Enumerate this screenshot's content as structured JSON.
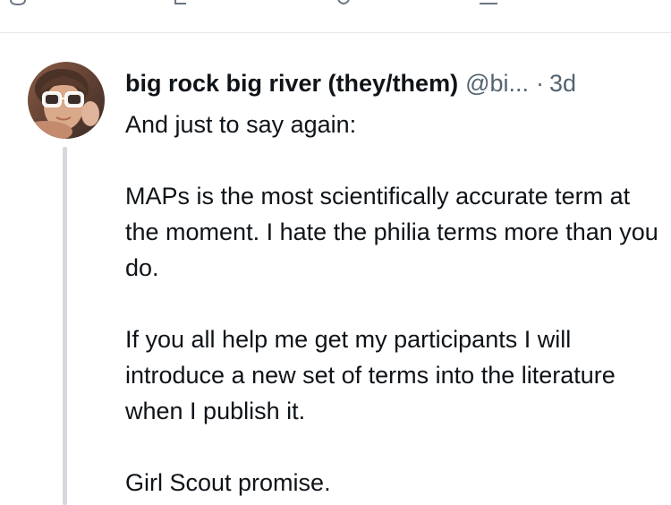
{
  "post": {
    "author": {
      "display_name": "big rock big river (they/them)",
      "handle": "@bi...",
      "separator": "·",
      "time": "3d"
    },
    "paragraphs": [
      "And just to say again:",
      "MAPs is the most scientifically accurate term at the moment. I hate the philia terms more than you do.",
      "If you all help me get my participants I will introduce a new set of terms into the literature when I publish it.",
      "Girl Scout promise."
    ]
  },
  "icons": {
    "top_bar": [
      "reply-icon",
      "repost-icon",
      "like-icon",
      "share-icon"
    ],
    "avatar": "user-avatar"
  },
  "colors": {
    "text_primary": "#0f1419",
    "text_secondary": "#536471",
    "thread_line": "#d4d9df",
    "divider": "#e6e8eb"
  }
}
